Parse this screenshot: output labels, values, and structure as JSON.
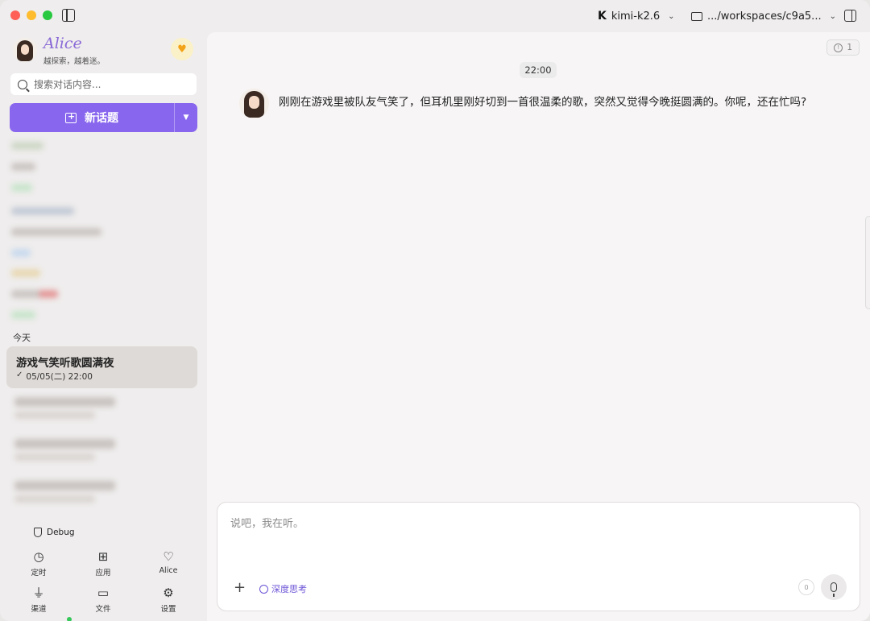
{
  "titlebar": {
    "model_label": "kimi-k2.6",
    "model_logo": "K",
    "workspace_path": ".../workspaces/c9a5..."
  },
  "sidebar": {
    "profile": {
      "name": "Alice",
      "tagline": "越探索，越着迷。"
    },
    "search": {
      "placeholder": "搜索对话内容..."
    },
    "new_topic_label": "新话题",
    "section_today": "今天",
    "active_conversation": {
      "title": "游戏气笑听歌圆满夜",
      "meta": "05/05(二) 22:00"
    },
    "debug_label": "Debug",
    "nav": [
      {
        "label": "定时",
        "icon": "clock-icon",
        "glyph": "◷"
      },
      {
        "label": "应用",
        "icon": "grid-icon",
        "glyph": "⊞"
      },
      {
        "label": "Alice",
        "icon": "heart-icon",
        "glyph": "♡"
      },
      {
        "label": "渠道",
        "icon": "plug-icon",
        "glyph": "⏚"
      },
      {
        "label": "文件",
        "icon": "folder-icon",
        "glyph": "▭"
      },
      {
        "label": "设置",
        "icon": "gear-icon",
        "glyph": "⚙"
      }
    ]
  },
  "main": {
    "alert_count": "1",
    "time_pill": "22:00",
    "message": "刚刚在游戏里被队友气笑了，但耳机里刚好切到一首很温柔的歌，突然又觉得今晚挺圆满的。你呢，还在忙吗?",
    "composer": {
      "placeholder": "说吧，我在听。",
      "deep_think_label": "深度思考",
      "count": "0"
    }
  },
  "colors": {
    "accent": "#8866ee",
    "heart": "#f3a318",
    "online": "#34c759"
  }
}
